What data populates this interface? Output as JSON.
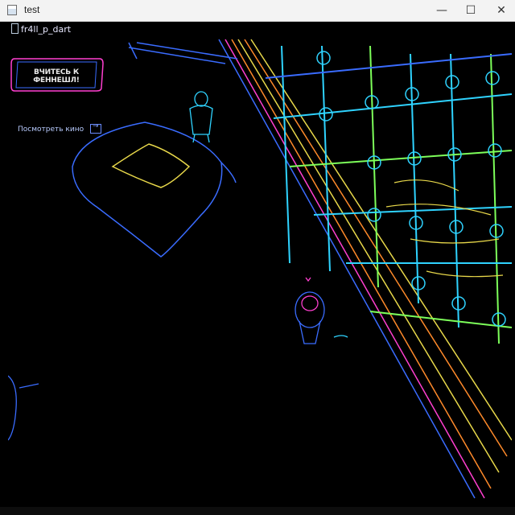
{
  "window": {
    "title": "test",
    "minimize_glyph": "—",
    "maximize_glyph": "☐",
    "close_glyph": "✕"
  },
  "scene": {
    "player_name": "fr4ll_p_dart",
    "primary_button_label": "ВЧИТЕСЬ К ФЕННЕШЛ!",
    "watch_label": "Посмотреть кино",
    "watch_toggle_glyph": "→"
  },
  "colors": {
    "edge_blue": "#3a6cff",
    "edge_cyan": "#2fd3ff",
    "edge_yellow": "#e8d84a",
    "edge_orange": "#ff8a2a",
    "edge_magenta": "#ff3fd0",
    "edge_green": "#7dff5a"
  },
  "icons": {
    "app": "app-window-icon",
    "minimize": "minimize-icon",
    "maximize": "maximize-icon",
    "close": "close-icon"
  }
}
